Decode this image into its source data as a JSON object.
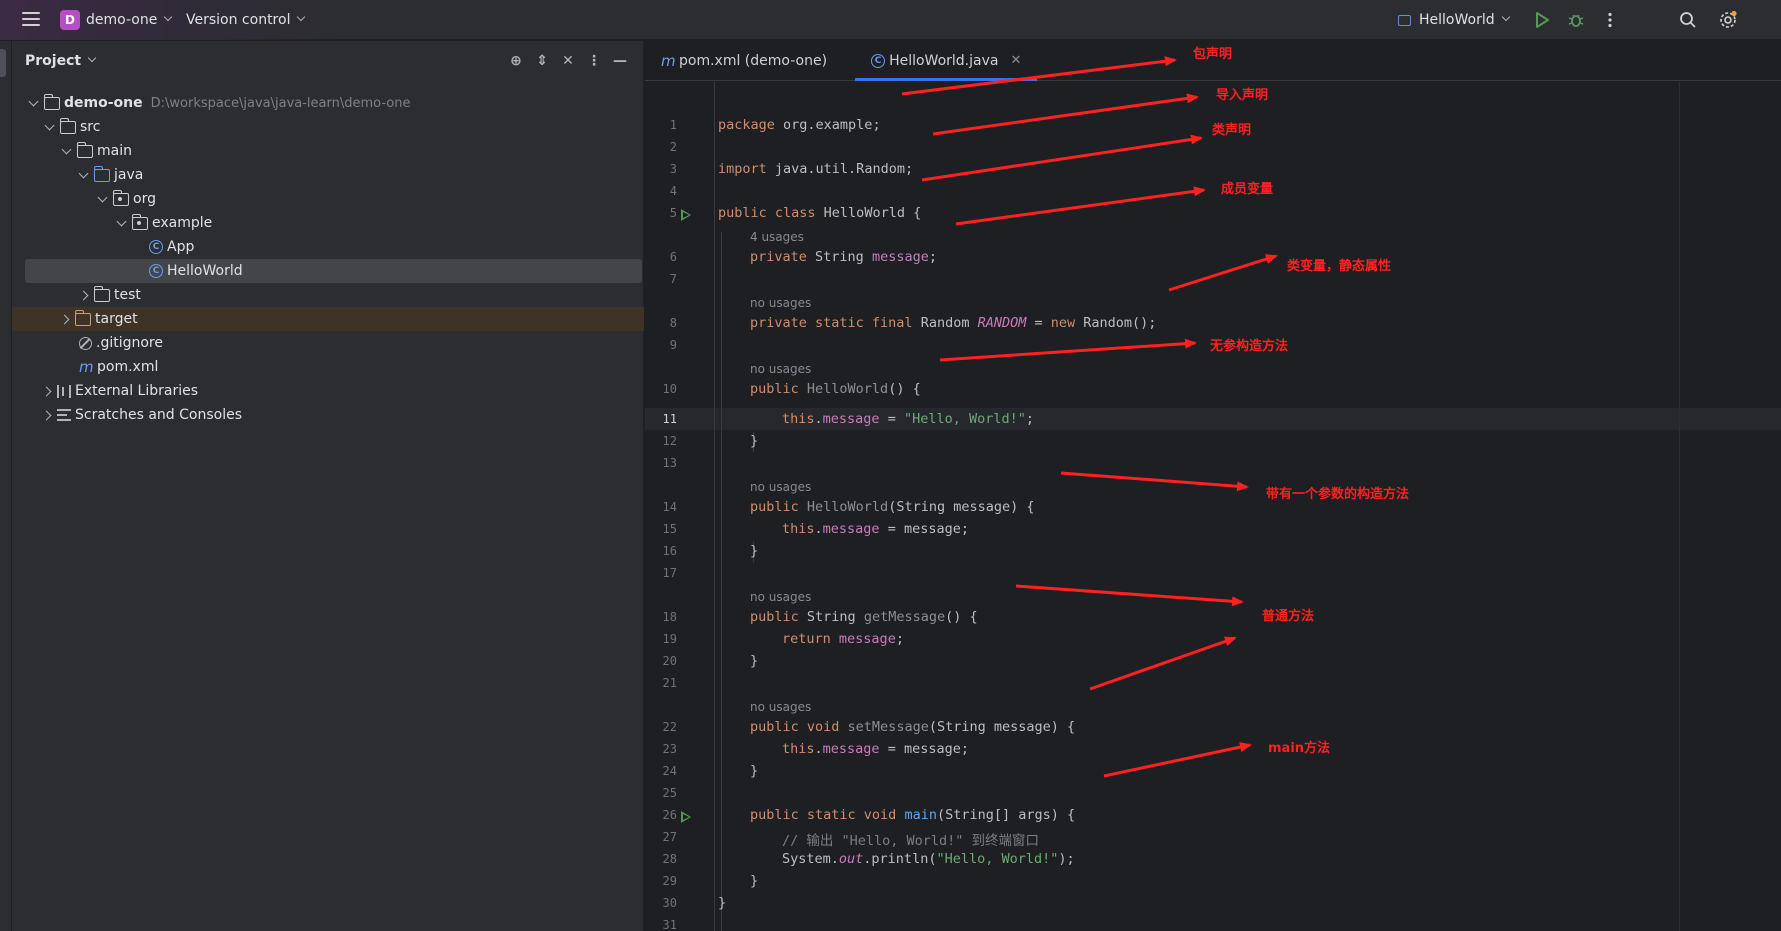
{
  "titlebar": {
    "project_badge": "D",
    "project_name": "demo-one",
    "vcs_label": "Version control",
    "run_config": "HelloWorld",
    "icons": [
      "hamburger-icon",
      "run-icon",
      "debug-icon",
      "more-icon",
      "search-icon",
      "settings-icon"
    ]
  },
  "project_panel": {
    "title": "Project",
    "root": {
      "name": "demo-one",
      "path": "D:\\workspace\\java\\java-learn\\demo-one"
    },
    "items": [
      {
        "label": "src"
      },
      {
        "label": "main"
      },
      {
        "label": "java"
      },
      {
        "label": "org"
      },
      {
        "label": "example"
      },
      {
        "label": "App"
      },
      {
        "label": "HelloWorld"
      },
      {
        "label": "test"
      },
      {
        "label": "target"
      },
      {
        "label": ".gitignore"
      },
      {
        "label": "pom.xml"
      },
      {
        "label": "External Libraries"
      },
      {
        "label": "Scratches and Consoles"
      }
    ]
  },
  "editor": {
    "tabs": [
      {
        "label": "pom.xml (demo-one)"
      },
      {
        "label": "HelloWorld.java"
      }
    ],
    "current_line": 11,
    "hints": {
      "usages4": "4 usages",
      "no_usages": "no usages"
    },
    "code": {
      "l1a": "package",
      "l1b": " org.example;",
      "l3a": "import",
      "l3b": " java.util.Random;",
      "l5a": "public class",
      "l5b": " HelloWorld {",
      "l6a": "private",
      "l6b": " String ",
      "l6c": "message",
      "l6d": ";",
      "l8a": "private static final",
      "l8b": " Random ",
      "l8c": "RANDOM",
      "l8d": " = ",
      "l8e": "new",
      "l8f": " Random();",
      "l10a": "public",
      "l10b": " HelloWorld",
      "l10c": "() {",
      "l11a": "this",
      "l11b": ".",
      "l11c": "message",
      "l11d": " = ",
      "l11e": "\"Hello, World!\"",
      "l11f": ";",
      "brace": "}",
      "l14a": "public",
      "l14b": " HelloWorld",
      "l14c": "(String message) {",
      "l15a": "this",
      "l15b": ".",
      "l15c": "message",
      "l15d": " = message;",
      "l18a": "public",
      "l18b": " String ",
      "l18c": "getMessage",
      "l18d": "() {",
      "l19a": "return",
      "l19b": " ",
      "l19c": "message",
      "l19d": ";",
      "l22a": "public void",
      "l22b": " ",
      "l22c": "setMessage",
      "l22d": "(String message) {",
      "l23a": "this",
      "l23b": ".",
      "l23c": "message",
      "l23d": " = message;",
      "l26a": "public static void",
      "l26b": " ",
      "l26c": "main",
      "l26d": "(String[] args) {",
      "l27": "// 输出 \"Hello, World!\" 到终端窗口",
      "l28a": "System.",
      "l28b": "out",
      "l28c": ".println(",
      "l28d": "\"Hello, World!\"",
      "l28e": ");"
    }
  },
  "annotations": {
    "package": "包声明",
    "import": "导入声明",
    "class": "类声明",
    "member": "成员变量",
    "static": "类变量，静态属性",
    "noarg": "无参构造方法",
    "onearg": "带有一个参数的构造方法",
    "method": "普通方法",
    "main": "main方法",
    "color": "#ff2020"
  }
}
